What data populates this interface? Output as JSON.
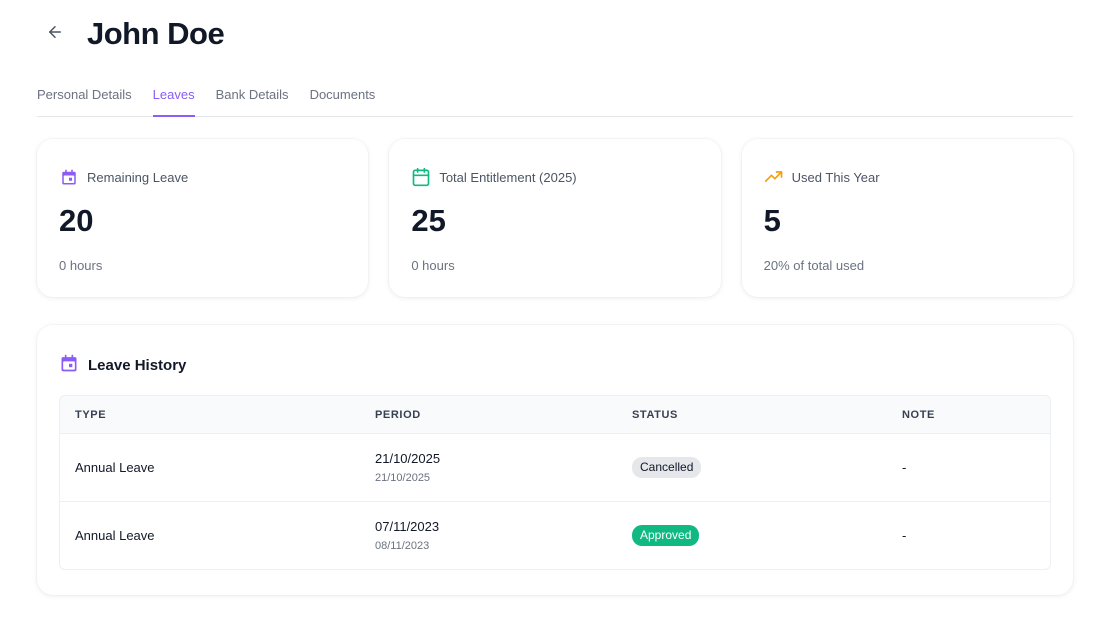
{
  "header": {
    "title": "John Doe",
    "back_icon": "arrow-left-icon"
  },
  "tabs": [
    {
      "label": "Personal Details",
      "active": false
    },
    {
      "label": "Leaves",
      "active": true
    },
    {
      "label": "Bank Details",
      "active": false
    },
    {
      "label": "Documents",
      "active": false
    }
  ],
  "stats": [
    {
      "icon": "calendar-icon",
      "icon_color": "#8b5cf6",
      "label": "Remaining Leave",
      "value": "20",
      "sub": "0 hours"
    },
    {
      "icon": "calendar-icon",
      "icon_color": "#10b981",
      "label": "Total Entitlement (2025)",
      "value": "25",
      "sub": "0 hours"
    },
    {
      "icon": "trending-up-icon",
      "icon_color": "#f59e0b",
      "label": "Used This Year",
      "value": "5",
      "sub": "20% of total used"
    }
  ],
  "history": {
    "title": "Leave History",
    "icon": "calendar-icon",
    "columns": [
      "TYPE",
      "PERIOD",
      "STATUS",
      "NOTE"
    ],
    "rows": [
      {
        "type": "Annual Leave",
        "period_start": "21/10/2025",
        "period_end": "21/10/2025",
        "status": "Cancelled",
        "status_kind": "cancelled",
        "note": "-"
      },
      {
        "type": "Annual Leave",
        "period_start": "07/11/2023",
        "period_end": "08/11/2023",
        "status": "Approved",
        "status_kind": "approved",
        "note": "-"
      }
    ]
  },
  "colors": {
    "accent": "#8b5cf6",
    "success": "#10b981",
    "warning": "#f59e0b"
  }
}
